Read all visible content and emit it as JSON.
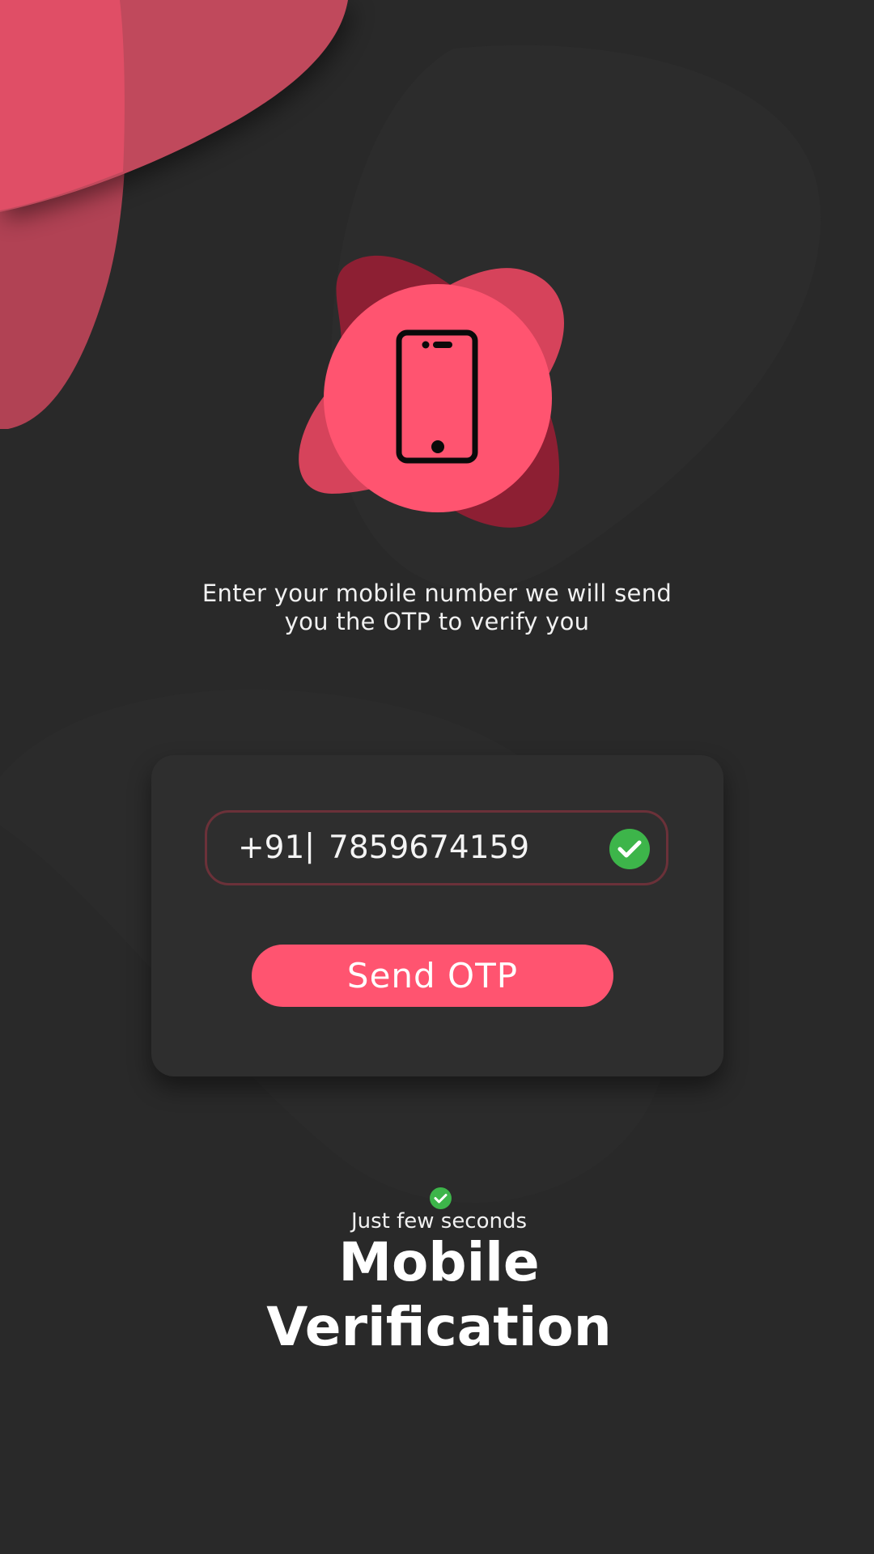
{
  "description": {
    "line1": "Enter your mobile number we will send",
    "line2": "you the OTP to verify you"
  },
  "phone_field": {
    "country_code": "+91",
    "separator": "|",
    "number": "7859674159",
    "status_icon": "check-circle-icon"
  },
  "send_button": {
    "label": "Send OTP"
  },
  "footer": {
    "status_icon": "check-circle-icon",
    "subtitle": "Just few seconds",
    "title_line1": "Mobile",
    "title_line2": "Verification"
  },
  "hero": {
    "icon": "smartphone-icon"
  },
  "colors": {
    "background": "#292929",
    "accent": "#ff5470",
    "accent_dark": "#8d1f33",
    "card": "#2e2e2e",
    "success": "#3db54a"
  }
}
